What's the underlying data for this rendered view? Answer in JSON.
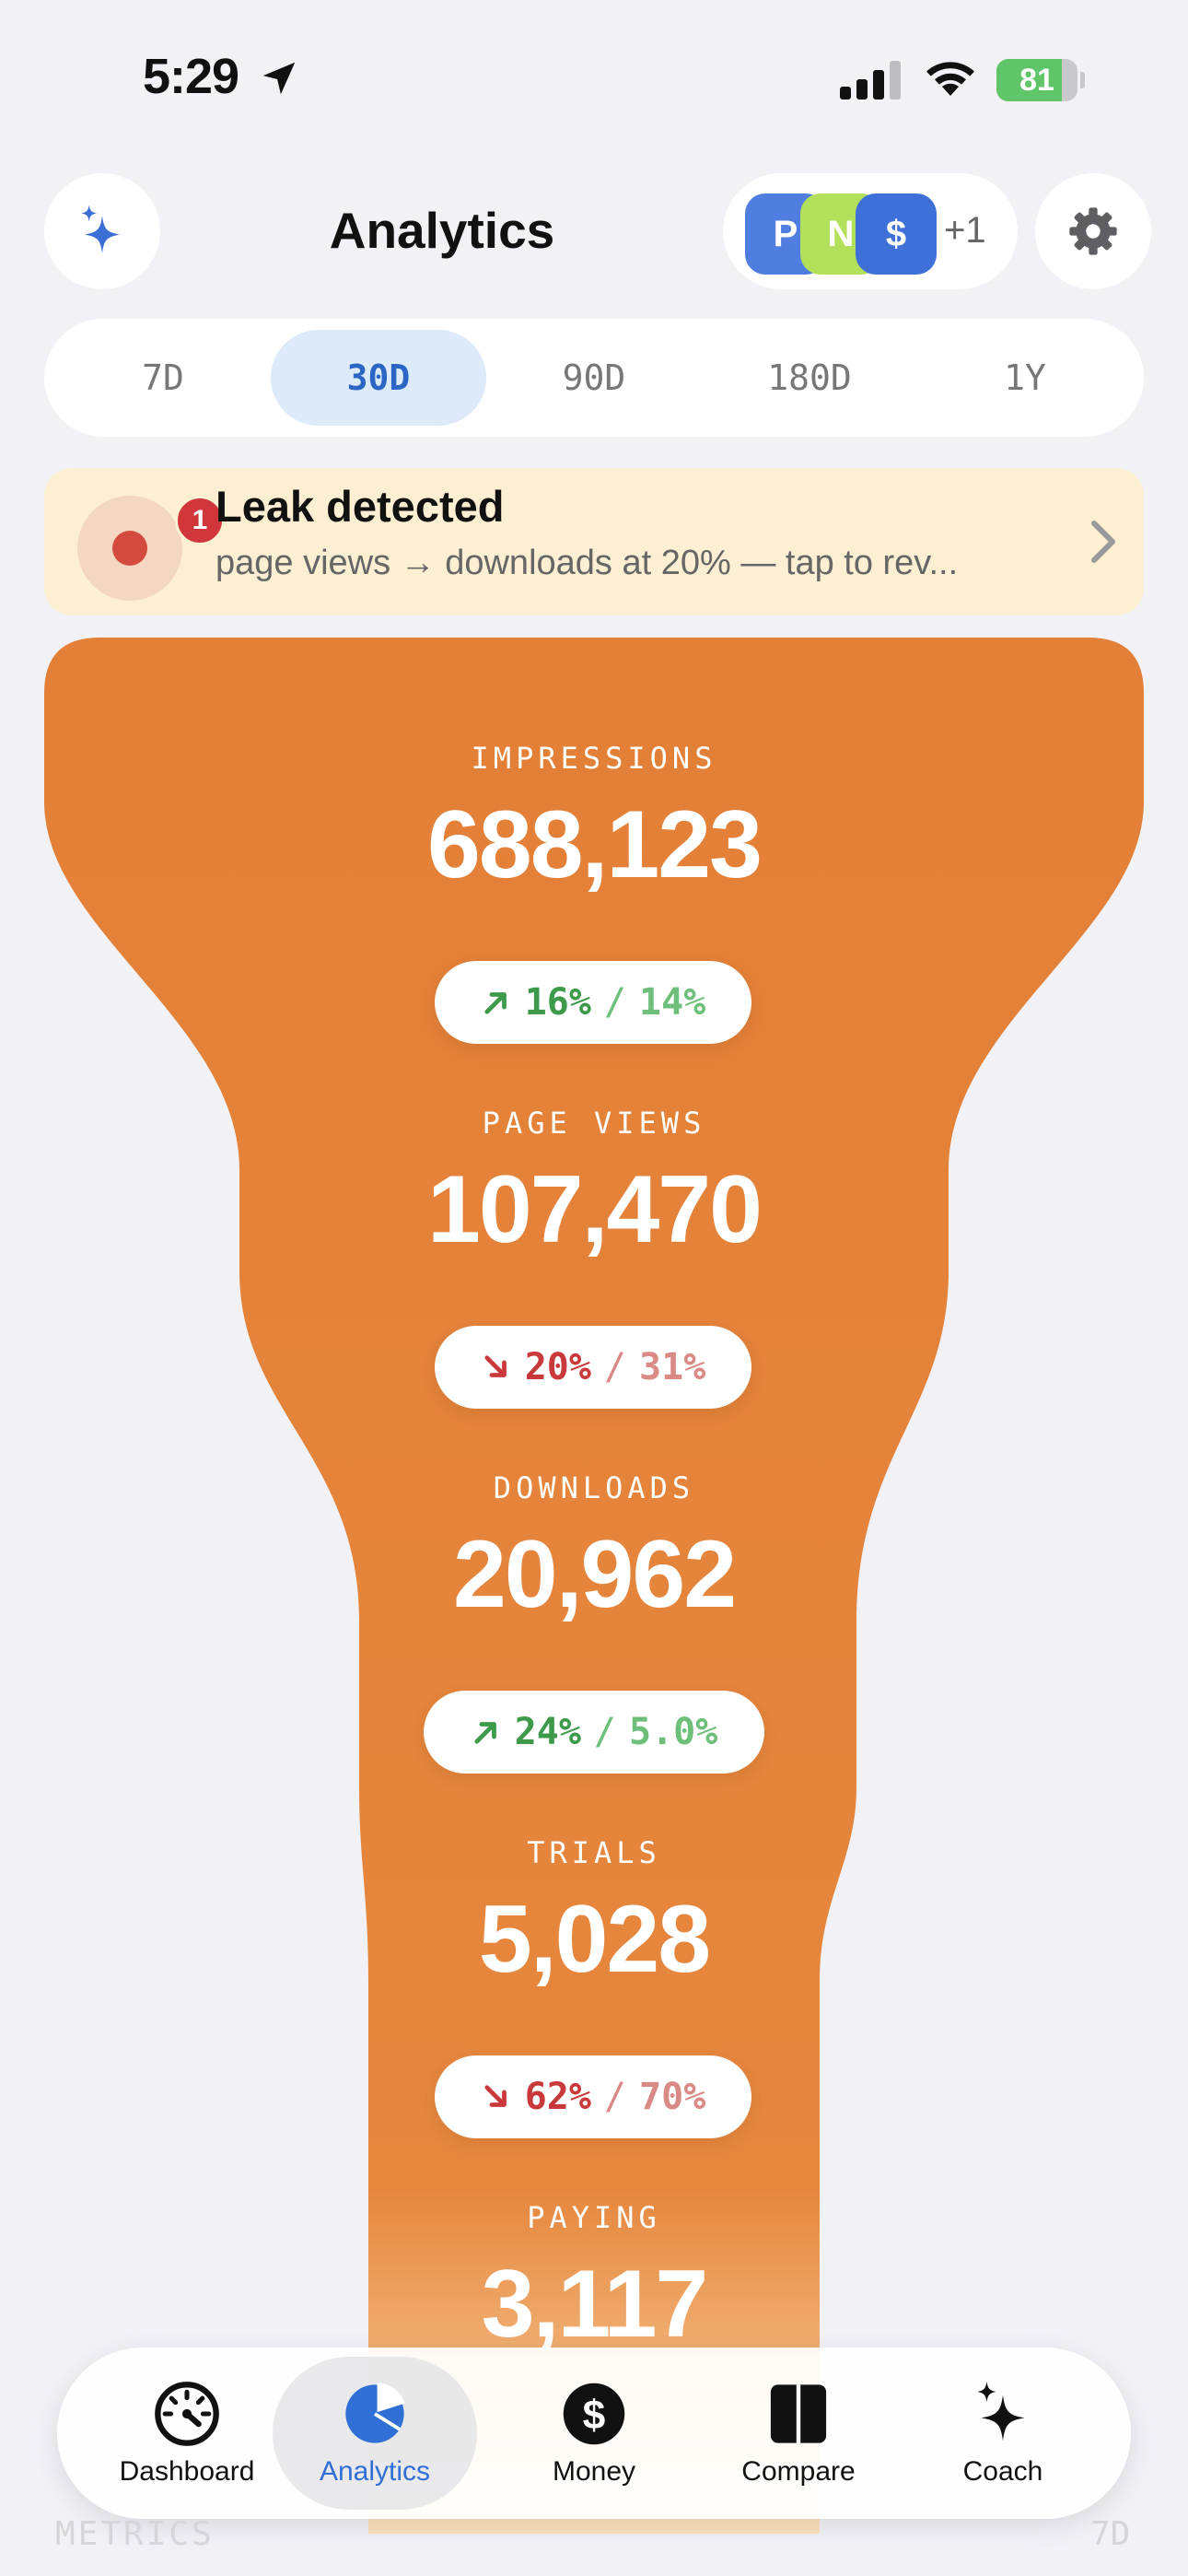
{
  "status_bar": {
    "time": "5:29",
    "battery": "81",
    "battery_level": 0.81
  },
  "header": {
    "title": "Analytics"
  },
  "apps": {
    "badges": [
      {
        "letter": "P",
        "color": "#4f7ee0"
      },
      {
        "letter": "N",
        "color": "#b3e05a"
      },
      {
        "letter": "$",
        "color": "#3f70d8"
      }
    ],
    "more": "+1"
  },
  "ranges": {
    "items": [
      "7D",
      "30D",
      "90D",
      "180D",
      "1Y"
    ],
    "selected": "30D"
  },
  "leak": {
    "count": "1",
    "title": "Leak detected",
    "subtitle": "page views → downloads at 20% — tap to rev..."
  },
  "funnel": {
    "color": "#e37f36",
    "stages": [
      {
        "label": "IMPRESSIONS",
        "value": "688,123"
      },
      {
        "label": "PAGE VIEWS",
        "value": "107,470"
      },
      {
        "label": "DOWNLOADS",
        "value": "20,962"
      },
      {
        "label": "TRIALS",
        "value": "5,028"
      },
      {
        "label": "PAYING",
        "value": "3,117"
      }
    ],
    "conversions": [
      {
        "direction": "up",
        "rate": "16%",
        "benchmark": "14%"
      },
      {
        "direction": "down",
        "rate": "20%",
        "benchmark": "31%"
      },
      {
        "direction": "up",
        "rate": "24%",
        "benchmark": "5.0%"
      },
      {
        "direction": "down",
        "rate": "62%",
        "benchmark": "70%"
      }
    ]
  },
  "tabbar": {
    "items": [
      {
        "label": "Dashboard",
        "icon": "speedometer-icon"
      },
      {
        "label": "Analytics",
        "icon": "pie-chart-icon"
      },
      {
        "label": "Money",
        "icon": "dollar-icon"
      },
      {
        "label": "Compare",
        "icon": "columns-icon"
      },
      {
        "label": "Coach",
        "icon": "sparkles-icon"
      }
    ],
    "selected": "Analytics"
  },
  "footer": {
    "left": "METRICS",
    "right": "7D"
  }
}
